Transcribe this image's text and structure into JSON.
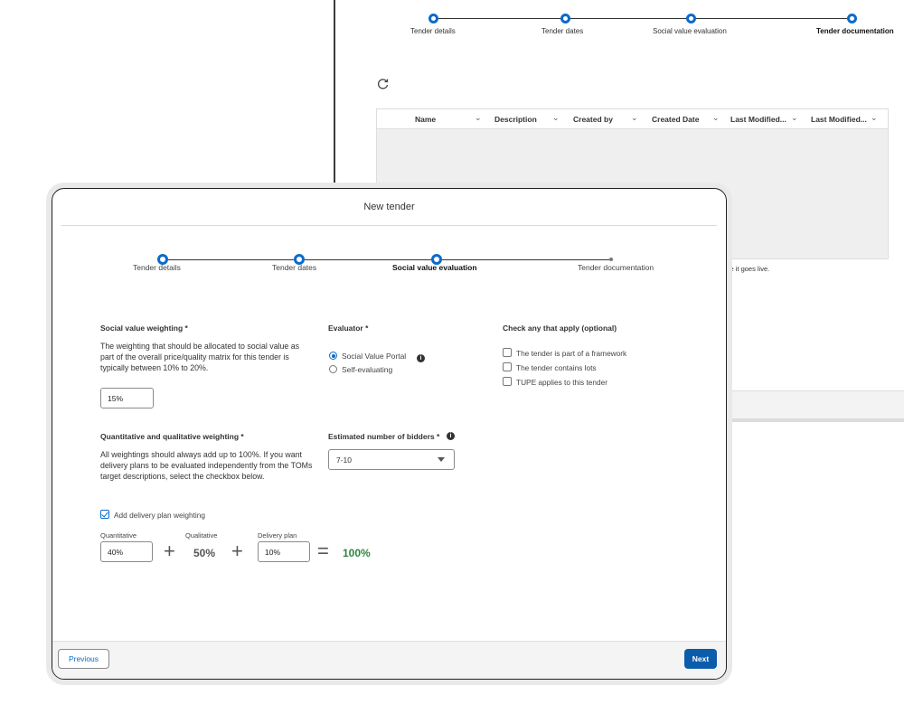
{
  "background": {
    "steps": [
      "Tender details",
      "Tender dates",
      "Social value evaluation",
      "Tender documentation"
    ],
    "table_headers": [
      "Name",
      "Description",
      "Created by",
      "Created Date",
      "Last Modified...",
      "Last Modified..."
    ],
    "live_text": "re it goes live."
  },
  "modal": {
    "title": "New tender",
    "steps": [
      "Tender details",
      "Tender dates",
      "Social value evaluation",
      "Tender documentation"
    ],
    "social_value": {
      "label": "Social value weighting *",
      "description": "The weighting that should be allocated to social value as part of the overall price/quality matrix for this tender is typically between 10% to 20%.",
      "value": "15%"
    },
    "evaluator": {
      "label": "Evaluator *",
      "options": [
        "Social Value Portal",
        "Self-evaluating"
      ],
      "selected": "Social Value Portal"
    },
    "check_apply": {
      "label": "Check any that apply (optional)",
      "options": [
        "The tender is part of a framework",
        "The tender contains lots",
        "TUPE applies to this tender"
      ]
    },
    "quant_qual": {
      "label": "Quantitative and qualitative weighting *",
      "description": "All weightings should always add up to 100%. If you want delivery plans to be evaluated independently from the TOMs target descriptions, select the checkbox below.",
      "checkbox_label": "Add delivery plan weighting",
      "quantitative_label": "Quantitative",
      "quantitative_value": "40%",
      "qualitative_label": "Qualitative",
      "qualitative_value": "50%",
      "delivery_label": "Delivery plan",
      "delivery_value": "10%",
      "total": "100%"
    },
    "bidders": {
      "label": "Estimated number of bidders *",
      "value": "7-10"
    },
    "buttons": {
      "previous": "Previous",
      "next": "Next"
    }
  },
  "colors": {
    "accent": "#0b6bcb",
    "primary_button": "#0b5cab",
    "total_green": "#2e8540"
  }
}
